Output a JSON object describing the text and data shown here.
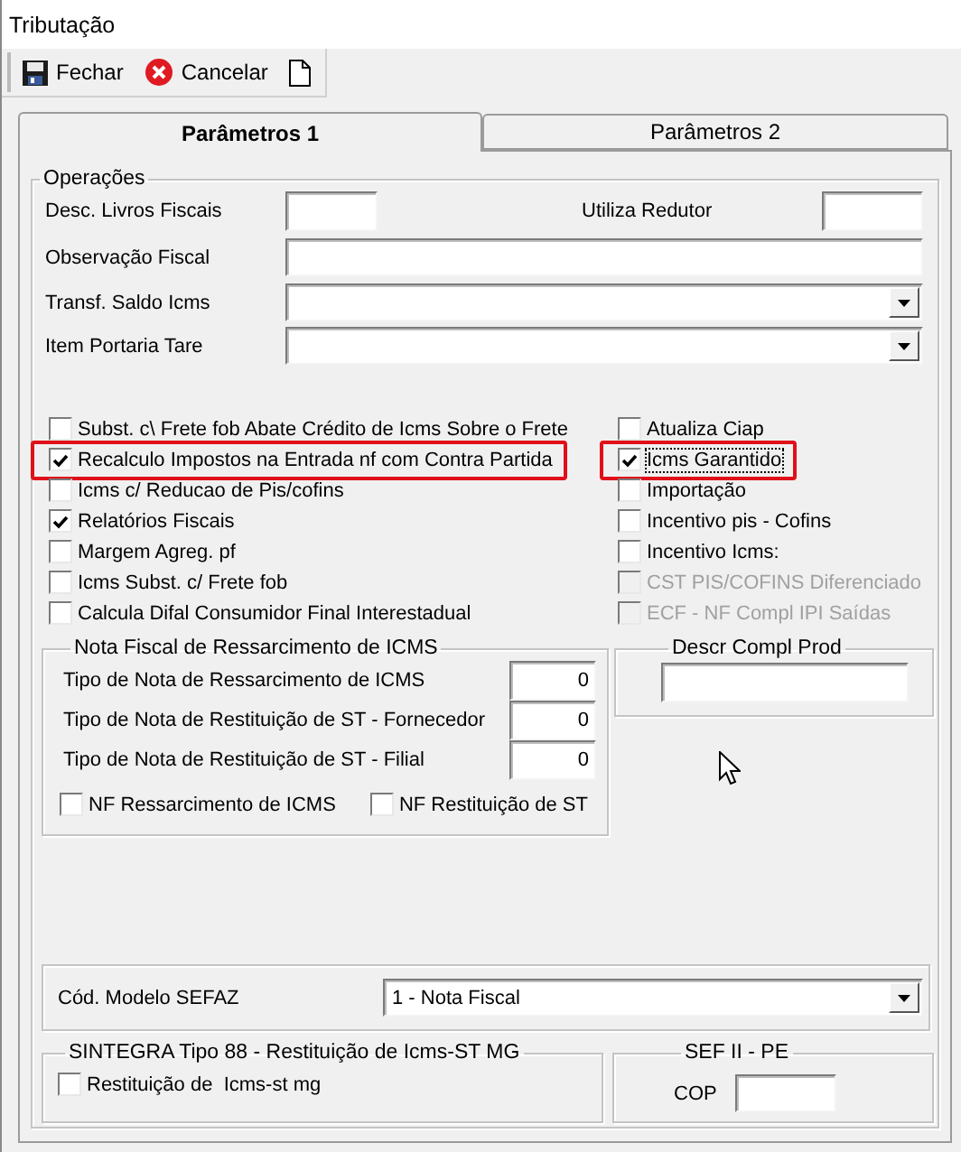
{
  "window": {
    "title": "Tributação"
  },
  "toolbar": [
    {
      "kind": "save",
      "label": "Fechar"
    },
    {
      "kind": "cancel",
      "label": "Cancelar"
    },
    {
      "kind": "new"
    }
  ],
  "tabs": [
    {
      "label": "Parâmetros 1",
      "selected": true
    },
    {
      "label": "Parâmetros 2",
      "selected": false
    }
  ],
  "operacoes": {
    "title": "Operações",
    "desc_livros": {
      "label": "Desc. Livros Fiscais"
    },
    "utiliza_redutor": {
      "label": "Utiliza Redutor"
    },
    "observacao": {
      "label": "Observação Fiscal"
    },
    "combos": [
      {
        "label": "Transf. Saldo Icms"
      },
      {
        "label": "Item Portaria Tare"
      }
    ],
    "checks_left": [
      {
        "label": "Subst. c\\ Frete fob Abate Crédito de Icms Sobre o Frete",
        "checked": false,
        "disabled": false,
        "highlighted": false
      },
      {
        "label": "Recalculo Impostos na Entrada nf com Contra Partida",
        "checked": true,
        "disabled": false,
        "highlighted": true
      },
      {
        "label": "Icms c/ Reducao de Pis/cofins",
        "checked": false,
        "disabled": false,
        "highlighted": false
      },
      {
        "label": "Relatórios Fiscais",
        "checked": true,
        "disabled": false,
        "highlighted": false
      },
      {
        "label": "Margem Agreg. pf",
        "checked": false,
        "disabled": false,
        "highlighted": false
      },
      {
        "label": "Icms Subst. c/ Frete fob",
        "checked": false,
        "disabled": false,
        "highlighted": false
      },
      {
        "label": "Calcula Difal Consumidor Final Interestadual",
        "checked": false,
        "disabled": false,
        "highlighted": false
      }
    ],
    "checks_right": [
      {
        "label": "Atualiza Ciap",
        "checked": false,
        "disabled": false,
        "highlighted": false,
        "focused": false
      },
      {
        "label": "Icms Garantido",
        "checked": true,
        "disabled": false,
        "highlighted": true,
        "focused": true
      },
      {
        "label": "Importação",
        "checked": false,
        "disabled": false,
        "highlighted": false,
        "focused": false
      },
      {
        "label": "Incentivo pis - Cofins",
        "checked": false,
        "disabled": false,
        "highlighted": false,
        "focused": false
      },
      {
        "label": "Incentivo Icms:",
        "checked": false,
        "disabled": false,
        "highlighted": false,
        "focused": false
      },
      {
        "label": "CST PIS/COFINS Diferenciado",
        "checked": false,
        "disabled": true,
        "highlighted": false,
        "focused": false
      },
      {
        "label": "ECF - NF Compl IPI Saídas",
        "checked": false,
        "disabled": true,
        "highlighted": false,
        "focused": false
      }
    ]
  },
  "nf_group": {
    "title": "Nota Fiscal de Ressarcimento de ICMS",
    "rows": [
      {
        "label": "Tipo de Nota de Ressarcimento de ICMS",
        "value": "0"
      },
      {
        "label": "Tipo de Nota de Restituição de ST - Fornecedor",
        "value": "0"
      },
      {
        "label": "Tipo de Nota de Restituição de ST - Filial",
        "value": "0"
      }
    ],
    "checks": [
      {
        "label": "NF Ressarcimento de ICMS",
        "checked": false
      },
      {
        "label": "NF Restituição de ST",
        "checked": false
      }
    ]
  },
  "descr_group": {
    "title": "Descr Compl Prod"
  },
  "modelo": {
    "label": "Cód. Modelo SEFAZ",
    "value": "1 - Nota Fiscal"
  },
  "sintegra": {
    "title": "SINTEGRA Tipo 88 - Restituição de Icms-ST MG",
    "check": {
      "label": "Restituição de  Icms-st mg",
      "checked": false
    }
  },
  "sef": {
    "title": "SEF II - PE",
    "label": "COP"
  }
}
